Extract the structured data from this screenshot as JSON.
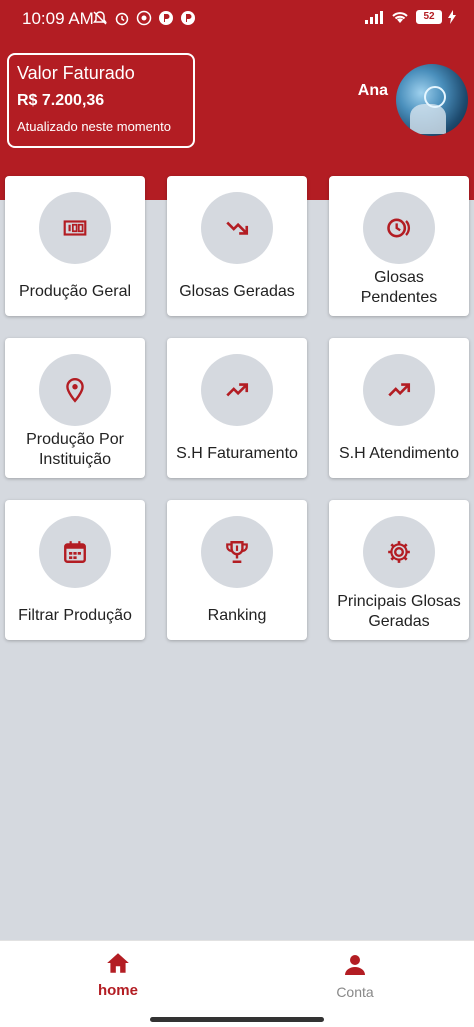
{
  "status_bar": {
    "time": "10:09 AM",
    "battery": "52",
    "icons_left": [
      "bell-off-icon",
      "alarm-icon",
      "whatsapp-icon",
      "app-icon",
      "app-icon"
    ],
    "icons_right": [
      "signal-icon",
      "wifi-icon",
      "battery-icon",
      "charging-icon"
    ]
  },
  "header": {
    "card_title": "Valor Faturado",
    "amount": "R$ 7.200,36",
    "updated": "Atualizado neste momento",
    "user_name": "Ana"
  },
  "tiles": [
    {
      "label": "Produção Geral",
      "icon": "barcode-icon"
    },
    {
      "label": "Glosas Geradas",
      "icon": "trending-down-icon"
    },
    {
      "label": "Glosas Pendentes",
      "icon": "clock-icon"
    },
    {
      "label": "Produção Por Instituição",
      "icon": "location-pin-icon"
    },
    {
      "label": "S.H Faturamento",
      "icon": "trending-up-icon"
    },
    {
      "label": "S.H Atendimento",
      "icon": "trending-up-icon"
    },
    {
      "label": "Filtrar Produção",
      "icon": "calendar-icon"
    },
    {
      "label": "Ranking",
      "icon": "trophy-icon"
    },
    {
      "label": "Principais Glosas Geradas",
      "icon": "gear-icon"
    }
  ],
  "nav": {
    "home": "home",
    "conta": "Conta"
  },
  "colors": {
    "brand_red": "#b31d23",
    "background": "#d5d9df",
    "inactive": "#888888"
  }
}
